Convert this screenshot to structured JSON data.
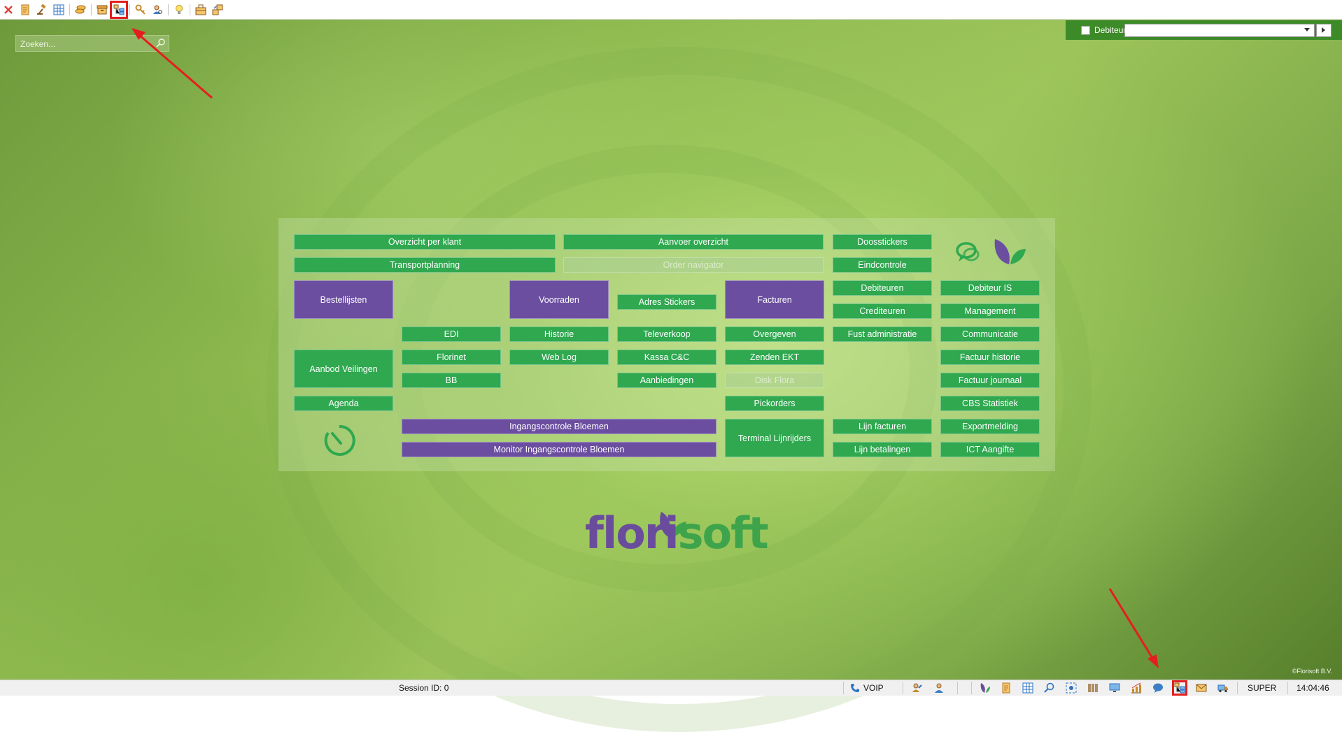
{
  "search": {
    "placeholder": "Zoeken..."
  },
  "debtor": {
    "label": "Debiteur",
    "value": ""
  },
  "buttons": {
    "overzicht_per_klant": "Overzicht per klant",
    "aanvoer_overzicht": "Aanvoer overzicht",
    "doosstickers": "Doosstickers",
    "transportplanning": "Transportplanning",
    "order_navigator": "Order navigator",
    "eindcontrole": "Eindcontrole",
    "bestellijsten": "Bestellijsten",
    "voorraden": "Voorraden",
    "adres_stickers": "Adres Stickers",
    "facturen": "Facturen",
    "debiteuren": "Debiteuren",
    "debiteur_is": "Debiteur IS",
    "crediteuren": "Crediteuren",
    "management": "Management",
    "edi": "EDI",
    "historie": "Historie",
    "televerkoop": "Televerkoop",
    "overgeven": "Overgeven",
    "fust_administratie": "Fust administratie",
    "communicatie": "Communicatie",
    "aanbod_veilingen": "Aanbod Veilingen",
    "florinet": "Florinet",
    "web_log": "Web Log",
    "kassa": "Kassa C&C",
    "zenden_ekt": "Zenden EKT",
    "factuur_historie": "Factuur historie",
    "bb": "BB",
    "aanbiedingen": "Aanbiedingen",
    "disk_flora": "Disk Flora",
    "factuur_journaal": "Factuur journaal",
    "agenda": "Agenda",
    "pickorders": "Pickorders",
    "cbs_statistiek": "CBS Statistiek",
    "ingangscontrole": "Ingangscontrole Bloemen",
    "terminal_lijnrijders": "Terminal Lijnrijders",
    "lijn_facturen": "Lijn facturen",
    "exportmelding": "Exportmelding",
    "monitor_ingangscontrole": "Monitor Ingangscontrole Bloemen",
    "lijn_betalingen": "Lijn betalingen",
    "ict_aangifte": "ICT Aangifte"
  },
  "logo": {
    "part1": "flori",
    "part2": "soft"
  },
  "copyright": "©Florisoft B.V.",
  "statusbar": {
    "session": "Session ID: 0",
    "voip": "VOIP",
    "user": "SUPER",
    "time": "14:04:46"
  },
  "colors": {
    "green_button": "#2fa84f",
    "purple_button": "#6b4ea0",
    "highlight": "#e41e1e"
  }
}
